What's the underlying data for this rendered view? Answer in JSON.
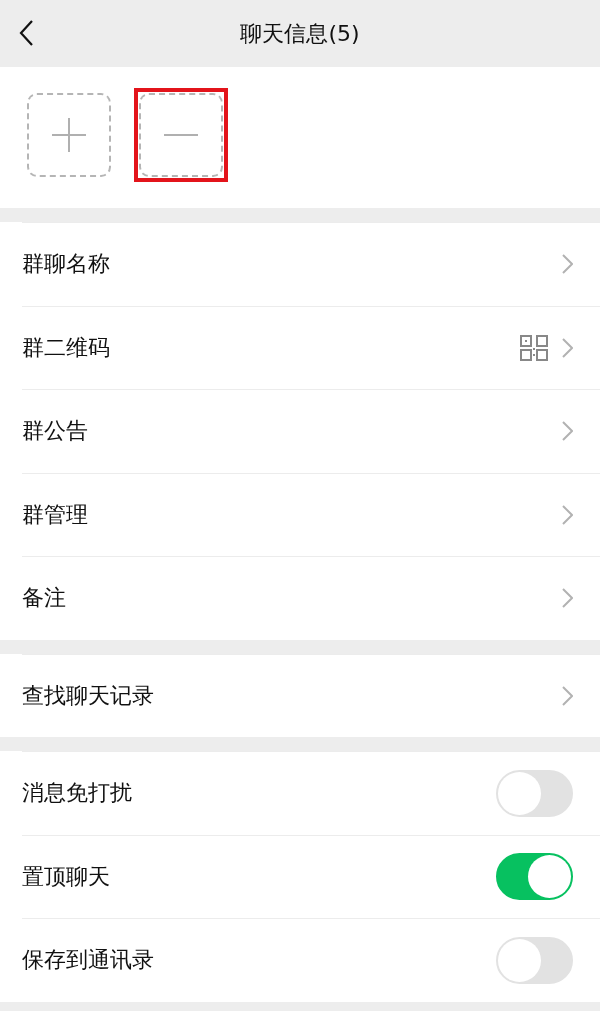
{
  "header": {
    "title": "聊天信息(5)"
  },
  "members": [
    {
      "kind": "add",
      "highlighted": false
    },
    {
      "kind": "remove",
      "highlighted": true
    }
  ],
  "groups": [
    {
      "items": [
        {
          "kind": "link",
          "label": "群聊名称"
        },
        {
          "kind": "qr-link",
          "label": "群二维码"
        },
        {
          "kind": "link",
          "label": "群公告"
        },
        {
          "kind": "link",
          "label": "群管理"
        },
        {
          "kind": "link",
          "label": "备注"
        }
      ]
    },
    {
      "items": [
        {
          "kind": "link",
          "label": "查找聊天记录"
        }
      ]
    },
    {
      "items": [
        {
          "kind": "switch",
          "label": "消息免打扰",
          "on": false
        },
        {
          "kind": "switch",
          "label": "置顶聊天",
          "on": true
        },
        {
          "kind": "switch",
          "label": "保存到通讯录",
          "on": false
        }
      ]
    }
  ]
}
